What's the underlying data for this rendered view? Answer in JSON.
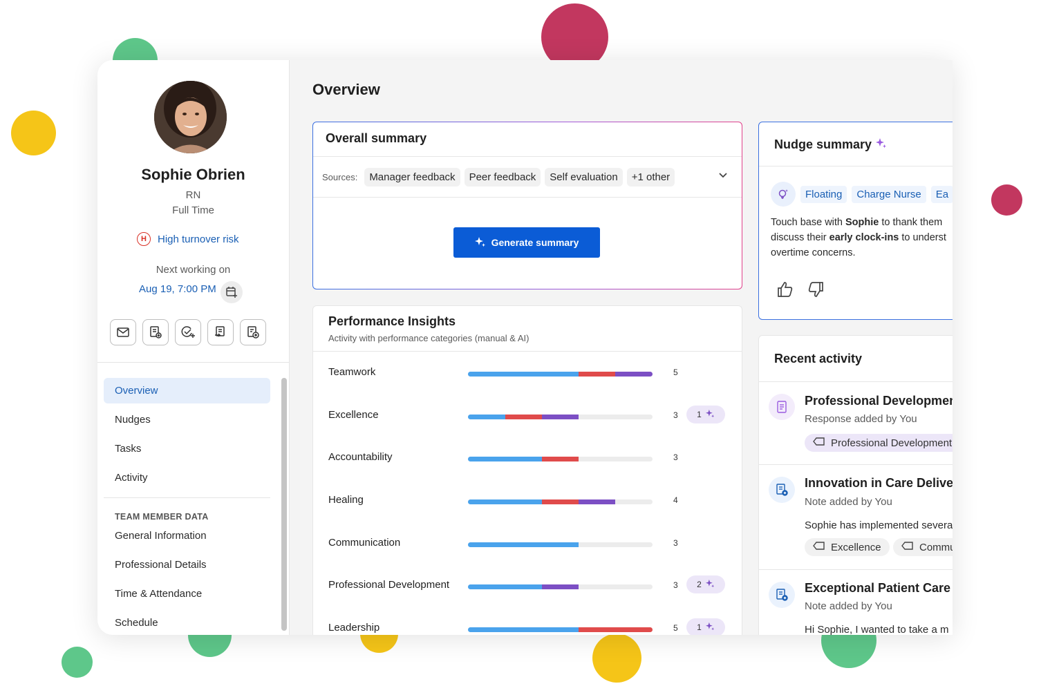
{
  "profile": {
    "name": "Sophie Obrien",
    "role": "RN",
    "employment": "Full Time",
    "risk_badge": "H",
    "risk_label": "High turnover risk",
    "next_working_label": "Next working on",
    "next_working_date": "Aug 19, 7:00 PM"
  },
  "sidebar": {
    "nav": [
      {
        "label": "Overview",
        "active": true
      },
      {
        "label": "Nudges"
      },
      {
        "label": "Tasks"
      },
      {
        "label": "Activity"
      }
    ],
    "section_heading": "TEAM MEMBER DATA",
    "section_items": [
      "General Information",
      "Professional Details",
      "Time & Attendance",
      "Schedule"
    ]
  },
  "main": {
    "title": "Overview",
    "summary": {
      "title": "Overall summary",
      "sources_label": "Sources:",
      "sources": [
        "Manager feedback",
        "Peer feedback",
        "Self evaluation",
        "+1 other"
      ],
      "button": "Generate summary"
    },
    "performance": {
      "title": "Performance Insights",
      "subtitle": "Activity with performance categories (manual & AI)",
      "rows": [
        {
          "label": "Teamwork",
          "count": "5",
          "ai": ""
        },
        {
          "label": "Excellence",
          "count": "3",
          "ai": "1"
        },
        {
          "label": "Accountability",
          "count": "3",
          "ai": ""
        },
        {
          "label": "Healing",
          "count": "4",
          "ai": ""
        },
        {
          "label": "Communication",
          "count": "3",
          "ai": ""
        },
        {
          "label": "Professional Development",
          "count": "3",
          "ai": "2"
        },
        {
          "label": "Leadership",
          "count": "5",
          "ai": "1"
        }
      ]
    },
    "nudge": {
      "title": "Nudge summary",
      "tags": [
        "Floating",
        "Charge Nurse",
        "Ea"
      ],
      "text_1a": "Touch base with ",
      "text_1b": "Sophie",
      "text_1c": " to thank them",
      "text_2a": "discuss their ",
      "text_2b": "early clock-ins",
      "text_2c": " to underst",
      "text_3": "overtime concerns."
    },
    "activity": {
      "title": "Recent activity",
      "items": [
        {
          "title": "Professional Development (",
          "meta": "Response added by You",
          "chip": "Professional Development"
        },
        {
          "title": "Innovation in Care Delivery",
          "meta": "Note added by You",
          "body": "Sophie has implemented severa",
          "chips": [
            "Excellence",
            "Commu"
          ]
        },
        {
          "title": "Exceptional Patient Care",
          "meta": "Note added by You",
          "body": "Hi Sophie, I wanted to take a m"
        }
      ]
    }
  },
  "colors": {
    "primary": "#0b5cd6",
    "teamwork_blue": "#4aa3ec",
    "red": "#e04b4b",
    "purple": "#7c4fc4",
    "dot_green": "#5ec78a",
    "dot_yellow": "#f5c518",
    "dot_crimson": "#c2375f"
  }
}
